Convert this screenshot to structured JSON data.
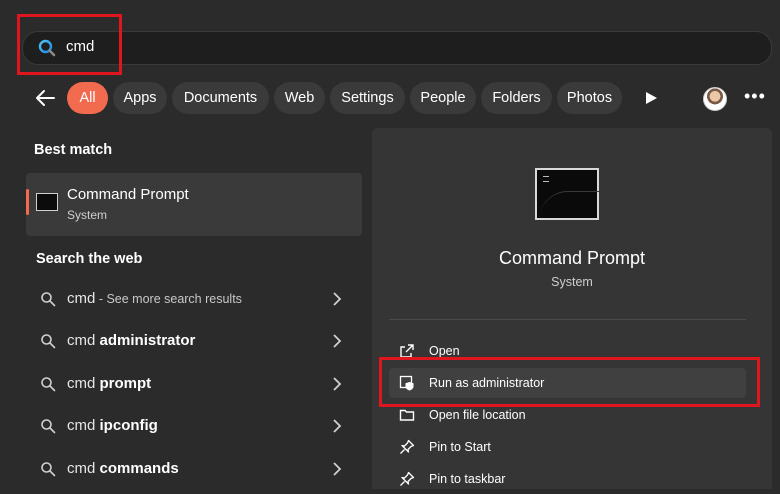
{
  "search": {
    "query": "cmd"
  },
  "filters": {
    "tabs": [
      {
        "label": "All",
        "active": true
      },
      {
        "label": "Apps"
      },
      {
        "label": "Documents"
      },
      {
        "label": "Web"
      },
      {
        "label": "Settings"
      },
      {
        "label": "People"
      },
      {
        "label": "Folders"
      },
      {
        "label": "Photos"
      }
    ]
  },
  "left": {
    "best_match_heading": "Best match",
    "best_match": {
      "title": "Command Prompt",
      "subtitle": "System"
    },
    "web_heading": "Search the web",
    "web_results": [
      {
        "query": "cmd",
        "suffix": "",
        "hint": " - See more search results"
      },
      {
        "query": "cmd ",
        "suffix": "administrator",
        "hint": ""
      },
      {
        "query": "cmd ",
        "suffix": "prompt",
        "hint": ""
      },
      {
        "query": "cmd ",
        "suffix": "ipconfig",
        "hint": ""
      },
      {
        "query": "cmd ",
        "suffix": "commands",
        "hint": ""
      }
    ]
  },
  "preview": {
    "title": "Command Prompt",
    "subtitle": "System",
    "actions": [
      {
        "label": "Open",
        "icon": "open-external-icon"
      },
      {
        "label": "Run as administrator",
        "icon": "shield-admin-icon"
      },
      {
        "label": "Open file location",
        "icon": "folder-icon"
      },
      {
        "label": "Pin to Start",
        "icon": "pin-icon"
      },
      {
        "label": "Pin to taskbar",
        "icon": "pin-icon"
      }
    ]
  },
  "colors": {
    "accent": "#f26b4f",
    "callout": "#e0161f",
    "background": "#2b2b2b"
  }
}
